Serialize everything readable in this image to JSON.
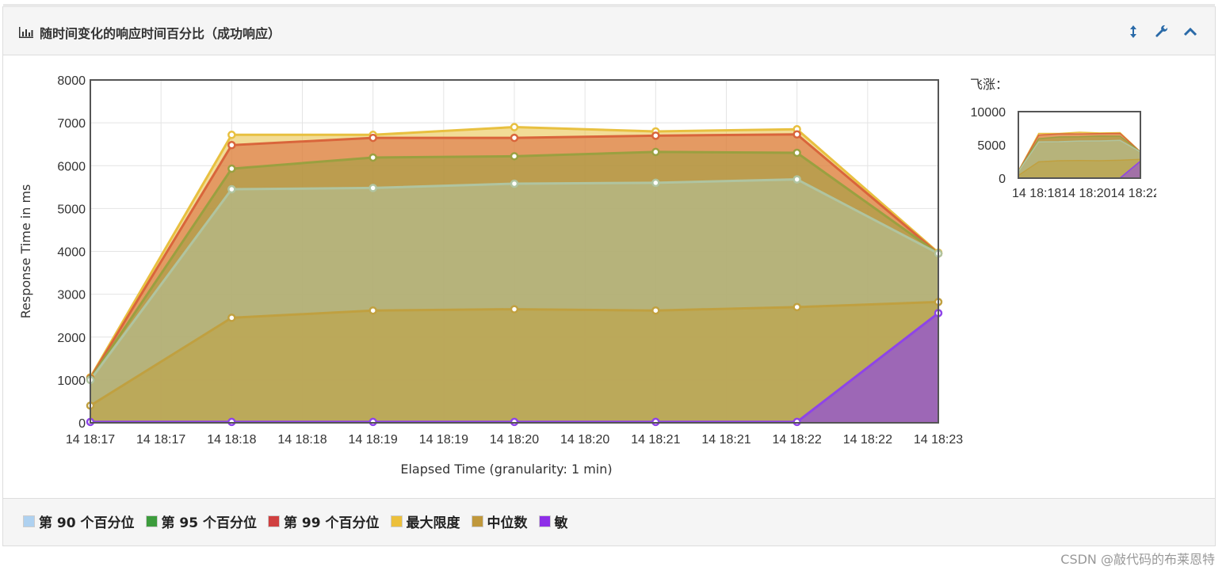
{
  "panel": {
    "title": "随时间变化的响应时间百分比（成功响应）",
    "title_icon": "bar-chart-icon",
    "tools": [
      "resize-vertical-icon",
      "wrench-icon",
      "chevron-up-icon"
    ]
  },
  "overview": {
    "title": "飞涨：",
    "yticks": [
      "10000",
      "5000",
      "0"
    ],
    "xticks_label": "14 18:1814 18:2014 18:22"
  },
  "chart_data": {
    "type": "area",
    "xlabel": "Elapsed Time (granularity: 1 min)",
    "ylabel": "Response Time in ms",
    "ylim": [
      0,
      8000
    ],
    "yticks": [
      0,
      1000,
      2000,
      3000,
      4000,
      5000,
      6000,
      7000,
      8000
    ],
    "xtick_labels": [
      "14 18:17",
      "14 18:17",
      "14 18:18",
      "14 18:18",
      "14 18:19",
      "14 18:19",
      "14 18:20",
      "14 18:20",
      "14 18:21",
      "14 18:21",
      "14 18:22",
      "14 18:22",
      "14 18:23"
    ],
    "x": [
      "14 18:17",
      "14 18:18",
      "14 18:19",
      "14 18:20",
      "14 18:21",
      "14 18:22",
      "14 18:23"
    ],
    "grid": true,
    "legend_position": "bottom",
    "series": [
      {
        "name": "第 90 个百分位",
        "color": "#b0c4a0",
        "values": [
          1000,
          5450,
          5480,
          5580,
          5600,
          5680,
          3950
        ]
      },
      {
        "name": "第 95 个百分位",
        "color": "#9aa040",
        "values": [
          1020,
          5930,
          6190,
          6220,
          6320,
          6300,
          3950
        ]
      },
      {
        "name": "第 99 个百分位",
        "color": "#d9653b",
        "values": [
          1040,
          6480,
          6650,
          6650,
          6700,
          6730,
          3950
        ]
      },
      {
        "name": "最大限度",
        "color": "#e8c040",
        "values": [
          1060,
          6720,
          6720,
          6900,
          6800,
          6850,
          3970
        ]
      },
      {
        "name": "中位数",
        "color": "#c0a040",
        "values": [
          400,
          2450,
          2620,
          2650,
          2620,
          2700,
          2820
        ]
      },
      {
        "name": "敏",
        "color": "#8e44e8",
        "values": [
          20,
          20,
          20,
          20,
          20,
          20,
          2560
        ]
      }
    ]
  },
  "legend": {
    "items": [
      {
        "label": "第 90 个百分位",
        "color": "#aed1f0"
      },
      {
        "label": "第 95 个百分位",
        "color": "#3c9c3c"
      },
      {
        "label": "第 99 个百分位",
        "color": "#d04040"
      },
      {
        "label": "最大限度",
        "color": "#ecc03c"
      },
      {
        "label": "中位数",
        "color": "#c0983c"
      },
      {
        "label": "敏",
        "color": "#8e2ee8"
      }
    ]
  },
  "watermark": "CSDN @敲代码的布莱恩特"
}
